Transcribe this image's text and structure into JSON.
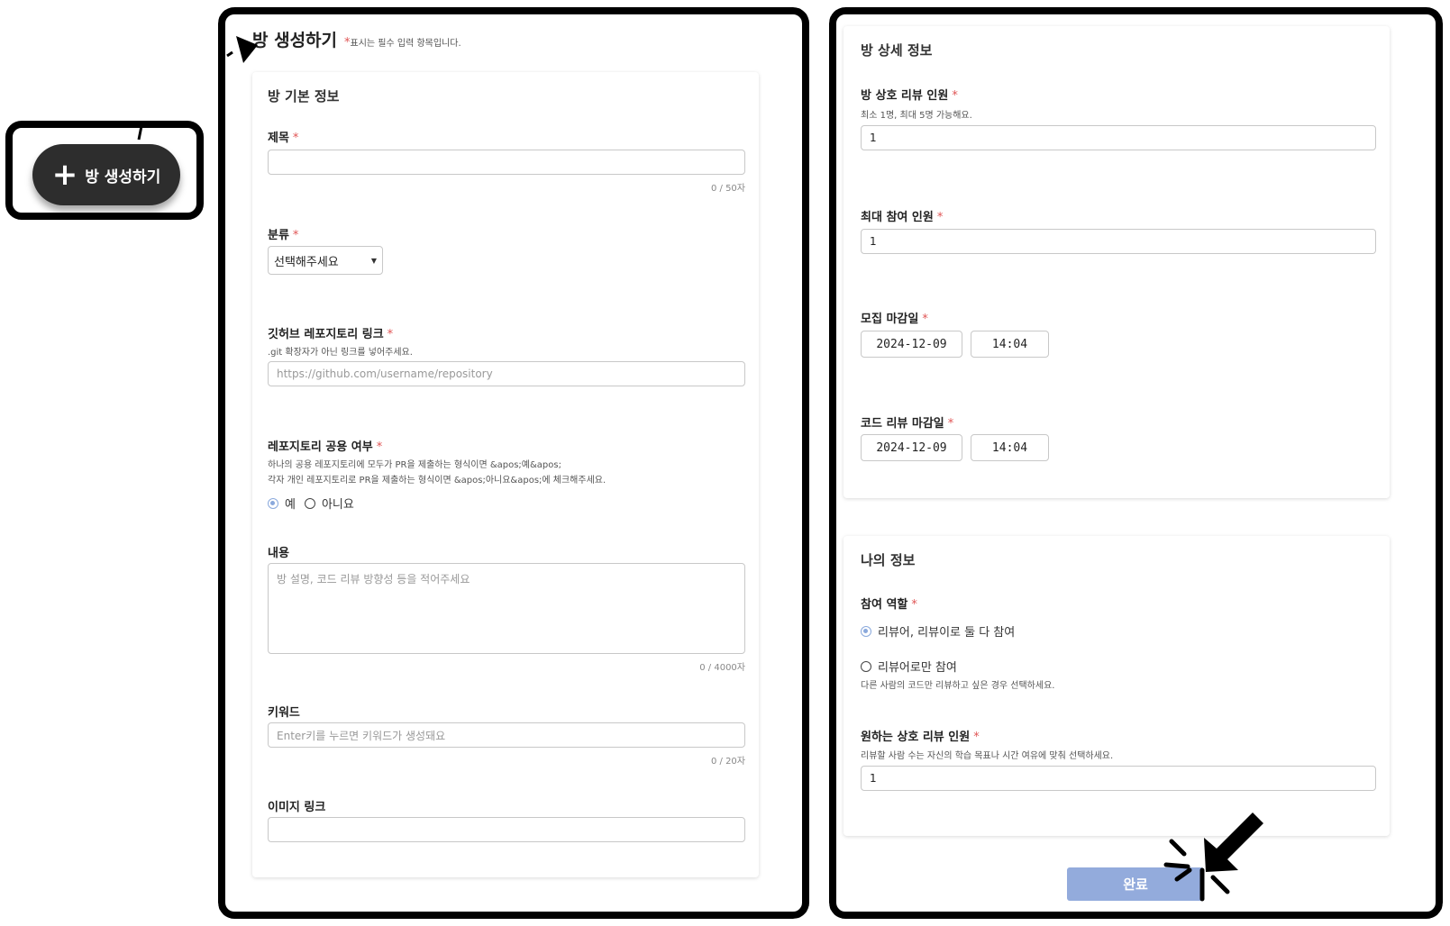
{
  "callout": {
    "fab_label": "방 생성하기",
    "fab_plus": "+"
  },
  "header": {
    "title": "방 생성하기",
    "required_star": "*",
    "required_note": "표시는 필수 입력 항목입니다."
  },
  "basic_info": {
    "section_title": "방 기본 정보",
    "title_field": {
      "label": "제목",
      "value": "",
      "counter": "0 / 50자"
    },
    "category": {
      "label": "분류",
      "selected": "선택해주세요"
    },
    "repo_link": {
      "label": "깃허브 레포지토리 링크",
      "help": ".git 확장자가 아닌 링크를 넣어주세요.",
      "placeholder": "https://github.com/username/repository"
    },
    "repo_shared": {
      "label": "레포지토리 공용 여부",
      "help_line1": "하나의 공용 레포지토리에 모두가 PR을 제출하는 형식이면 &apos;예&apos;",
      "help_line2": "각자 개인 레포지토리로 PR을 제출하는 형식이면 &apos;아니요&apos;에 체크해주세요.",
      "option_yes": "예",
      "option_no": "아니요"
    },
    "content": {
      "label": "내용",
      "placeholder": "방 설명, 코드 리뷰 방향성 등을 적어주세요",
      "counter": "0 / 4000자"
    },
    "keywords": {
      "label": "키워드",
      "placeholder": "Enter키를 누르면 키워드가 생성돼요",
      "counter": "0 / 20자"
    },
    "image_link": {
      "label": "이미지 링크",
      "value": ""
    }
  },
  "detail_info": {
    "section_title": "방 상세 정보",
    "mutual_review": {
      "label": "방 상호 리뷰 인원",
      "help": "최소 1명, 최대 5명 가능해요.",
      "value": "1"
    },
    "max_participants": {
      "label": "최대 참여 인원",
      "value": "1"
    },
    "recruit_deadline": {
      "label": "모집 마감일",
      "date": "2024-12-09",
      "time": "14:04"
    },
    "review_deadline": {
      "label": "코드 리뷰 마감일",
      "date": "2024-12-09",
      "time": "14:04"
    }
  },
  "my_info": {
    "section_title": "나의 정보",
    "role": {
      "label": "참여 역할",
      "option_both": "리뷰어, 리뷰이로 둘 다 참여",
      "option_reviewer": "리뷰어로만 참여",
      "help": "다른 사람의 코드만 리뷰하고 싶은 경우 선택하세요."
    },
    "desired_review": {
      "label": "원하는 상호 리뷰 인원",
      "help": "리뷰할 사람 수는 자신의 학습 목표나 시간 여유에 맞춰 선택하세요.",
      "value": "1"
    }
  },
  "submit_label": "완료",
  "colors": {
    "accent": "#93abdc",
    "required": "#e05555",
    "fab": "#2d2d2d"
  },
  "icons": [
    "plus-icon",
    "caret-down-icon",
    "arrow-cursor-icon",
    "click-burst-icon"
  ]
}
